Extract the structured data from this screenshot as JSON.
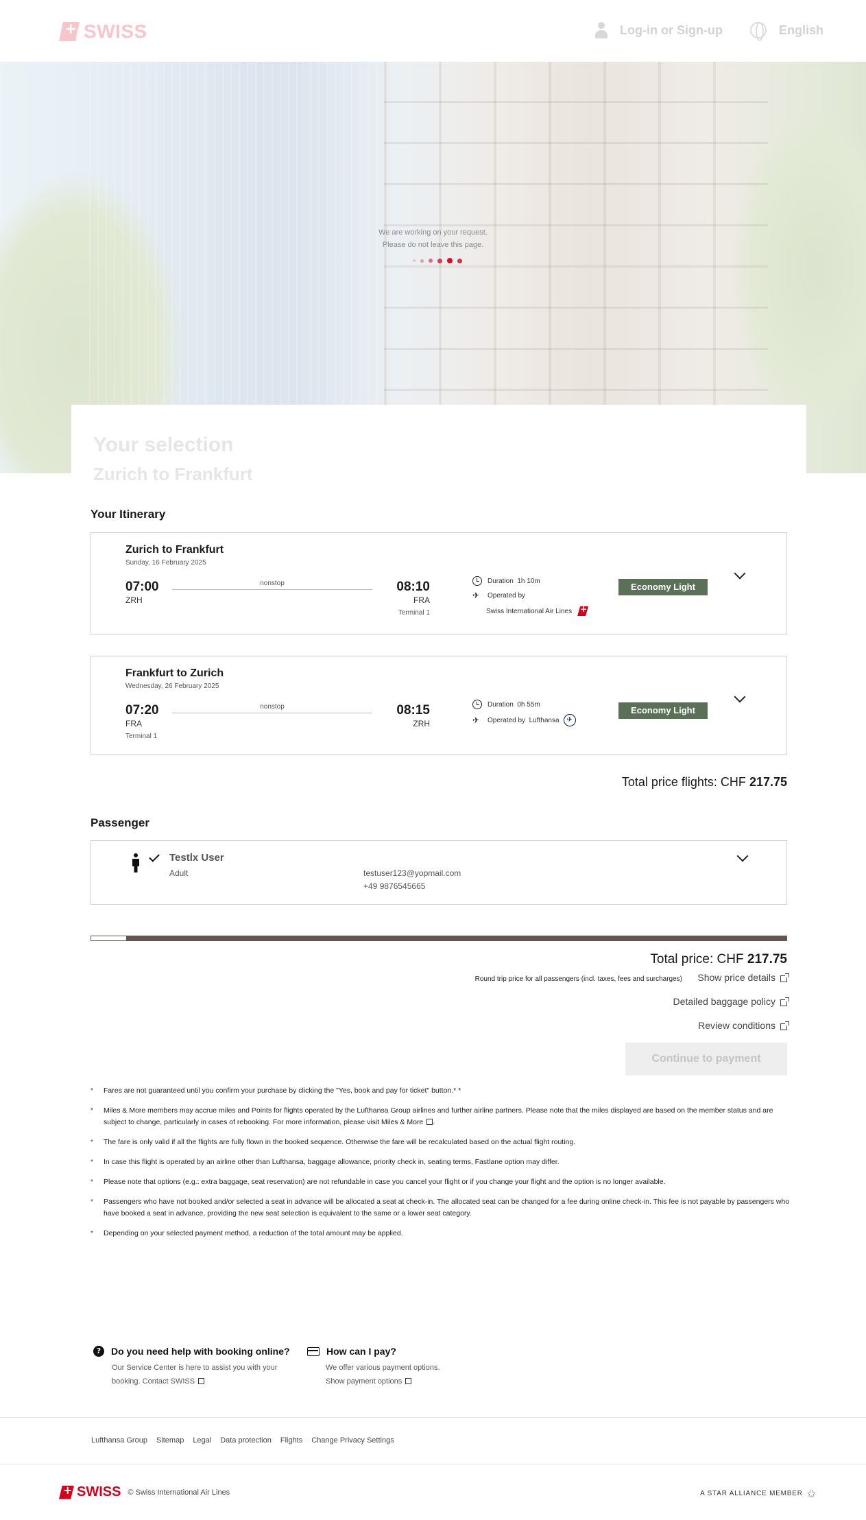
{
  "header": {
    "logo_text": "SWISS",
    "login_label": "Log-in or Sign-up",
    "language_label": "English"
  },
  "loader": {
    "line1": "We are working on your request.",
    "line2": "Please do not leave this page."
  },
  "selection": {
    "title": "Your selection",
    "subtitle": "Zurich to Frankfurt"
  },
  "itinerary": {
    "title": "Your Itinerary",
    "flights": [
      {
        "route": "Zurich to Frankfurt",
        "date": "Sunday, 16 February 2025",
        "dep_time": "07:00",
        "dep_code": "ZRH",
        "stops": "nonstop",
        "arr_time": "08:10",
        "arr_code": "FRA",
        "terminal": "Terminal 1",
        "duration_label": "Duration",
        "duration": "1h 10m",
        "operated_label": "Operated by",
        "operator": "Swiss International Air Lines",
        "fare": "Economy Light"
      },
      {
        "route": "Frankfurt to Zurich",
        "date": "Wednesday, 26 February 2025",
        "dep_time": "07:20",
        "dep_code": "FRA",
        "stops": "nonstop",
        "arr_time": "08:15",
        "arr_code": "ZRH",
        "terminal": "Terminal 1",
        "duration_label": "Duration",
        "duration": "0h 55m",
        "operated_label": "Operated by",
        "operator": "Lufthansa",
        "fare": "Economy Light"
      }
    ],
    "total_flights_label": "Total price flights: CHF",
    "total_flights_value": "217.75"
  },
  "passenger": {
    "title": "Passenger",
    "name": "Testlx User",
    "type": "Adult",
    "email": "testuser123@yopmail.com",
    "phone": "+49 9876545665"
  },
  "progress": {
    "fraction": 0.05
  },
  "summary": {
    "total_label": "Total price: CHF",
    "total_value": "217.75",
    "round_trip_note": "Round trip price for all passengers (incl. taxes, fees and surcharges)",
    "show_price_details": "Show price details",
    "baggage_policy": "Detailed baggage policy",
    "review_conditions": "Review conditions",
    "continue_label": "Continue to payment"
  },
  "notes": [
    "Fares are not guaranteed until you confirm your purchase by clicking the \"Yes, book and pay for ticket\" button.* *",
    "Miles & More members may accrue miles and Points for flights operated by the Lufthansa Group airlines and further airline partners. Please note that the miles displayed are based on the member status and are subject to change, particularly in cases of rebooking. For more information, please visit Miles & More",
    "The fare is only valid if all the flights are fully flown in the booked sequence. Otherwise the fare will be recalculated based on the actual flight routing.",
    "In case this flight is operated by an airline other than Lufthansa, baggage allowance, priority check in, seating terms, Fastlane option may differ.",
    "Please note that options (e.g.: extra baggage, seat reservation) are not refundable in case you cancel your flight or if you change your flight and the option is no longer available.",
    "Passengers who have not booked and/or selected a seat in advance will be allocated a seat at check-in. The allocated seat can be changed for a fee during online check-in. This fee is not payable by passengers who have booked a seat in advance, providing the new seat selection is equivalent to the same or a lower seat category.",
    "Depending on your selected payment method, a reduction of the total amount may be applied."
  ],
  "help": {
    "booking_title": "Do you need help with booking online?",
    "booking_text": "Our Service Center is here to assist you with your",
    "booking_link_prefix": "booking.",
    "booking_link": "Contact SWISS",
    "pay_title": "How can I pay?",
    "pay_text": "We offer various payment options.",
    "pay_link": "Show payment options"
  },
  "footer": {
    "links": [
      "Lufthansa Group",
      "Sitemap",
      "Legal",
      "Data protection",
      "Flights",
      "Change Privacy Settings"
    ],
    "logo_text": "SWISS",
    "copyright": "© Swiss International Air Lines",
    "alliance": "A STAR ALLIANCE MEMBER"
  },
  "colors": {
    "brand_red": "#d6001c",
    "fare_badge": "#5a7158",
    "progress_bar": "#605850"
  }
}
